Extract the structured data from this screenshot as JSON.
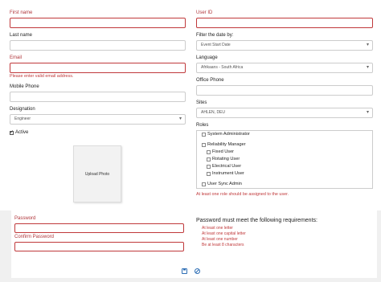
{
  "form": {
    "first_name": {
      "label": "First name",
      "value": ""
    },
    "last_name": {
      "label": "Last name",
      "value": ""
    },
    "email": {
      "label": "Email",
      "value": "",
      "error": "Please enter valid email address."
    },
    "mobile_phone": {
      "label": "Mobile Phone",
      "value": ""
    },
    "designation": {
      "label": "Designation",
      "value": "Engineer"
    },
    "active": {
      "label": "Active",
      "checked": true
    },
    "upload_photo": "Upload Photo",
    "user_id": {
      "label": "User ID",
      "value": ""
    },
    "filter_date": {
      "label": "Filter the date by:",
      "value": "Event Start Date"
    },
    "language": {
      "label": "Language",
      "value": "Afrikaans - South Africa"
    },
    "office_phone": {
      "label": "Office Phone",
      "value": ""
    },
    "sites": {
      "label": "Sites",
      "value": "AHLEN, DEU"
    },
    "roles": {
      "label": "Roles",
      "items": [
        {
          "label": "System Administrator",
          "checked": false
        },
        {
          "label": "Reliability Manager",
          "checked": false
        },
        {
          "label": "Fixed User",
          "checked": false
        },
        {
          "label": "Rotating User",
          "checked": false
        },
        {
          "label": "Electrical User",
          "checked": false
        },
        {
          "label": "Instrument User",
          "checked": false
        },
        {
          "label": "User Sync Admin",
          "checked": false
        }
      ],
      "error": "At least one role should be assigned to the user."
    },
    "password": {
      "label": "Password",
      "value": ""
    },
    "confirm_password": {
      "label": "Confirm Password",
      "value": ""
    },
    "password_requirements": {
      "title": "Password must meet the following requirements:",
      "items": [
        {
          "prefix": "At least ",
          "emph": "one letter"
        },
        {
          "prefix": "At least ",
          "emph": "one capital letter"
        },
        {
          "prefix": "At least ",
          "emph": "one number"
        },
        {
          "prefix": "Be at least ",
          "emph": "8 characters"
        }
      ]
    }
  },
  "toolbar": {
    "save_icon": "save-icon",
    "cancel_icon": "cancel-icon"
  },
  "colors": {
    "error": "#c0393b",
    "label_error": "#b0353a"
  }
}
